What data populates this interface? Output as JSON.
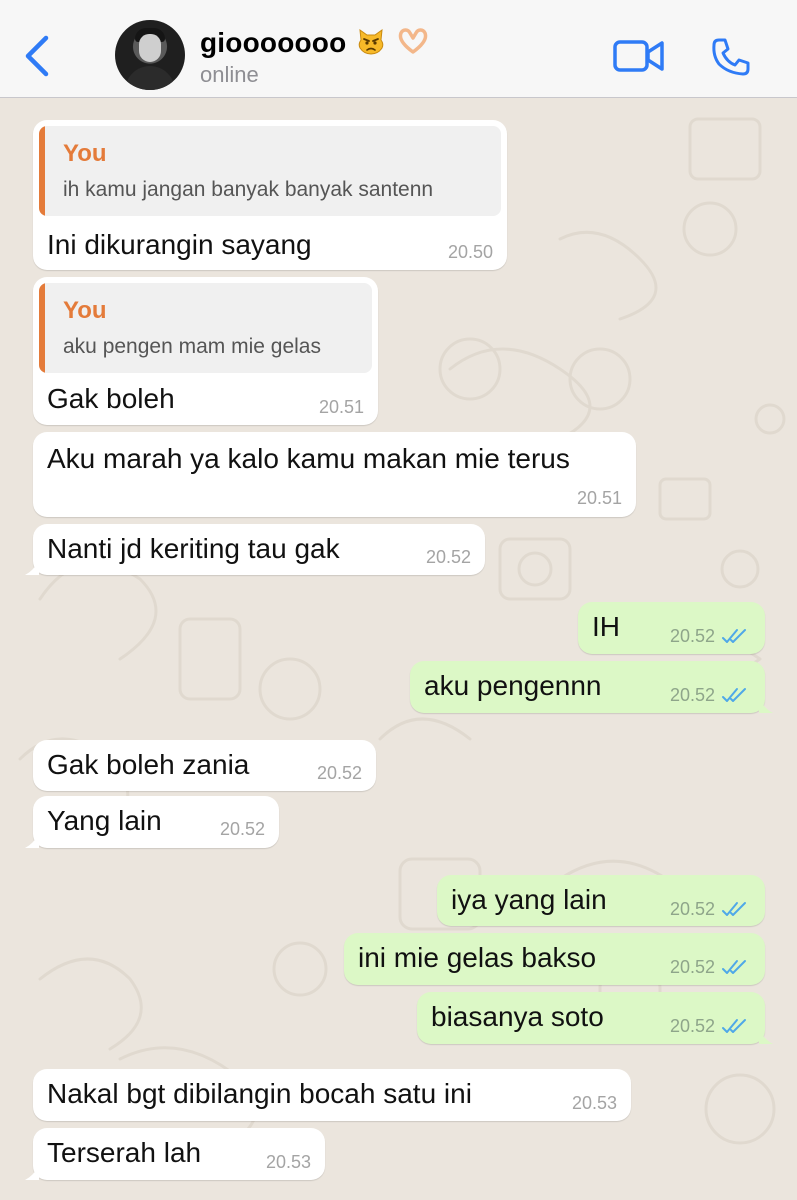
{
  "header": {
    "name": "giooooooo",
    "status": "online",
    "emoji_1": "pouting-cat",
    "emoji_2": "heart-hands"
  },
  "colors": {
    "accent": "#2f7bf6",
    "incoming": "#ffffff",
    "outgoing": "#dcf8c6",
    "quote": "#e47b3a",
    "read_ticks": "#4fa8e8",
    "background": "#ebe5dd"
  },
  "messages": [
    {
      "dir": "in",
      "quote_author": "You",
      "quote_text": "ih kamu jangan banyak banyak santenn",
      "text": "Ini dikurangin sayang",
      "time": "20.50"
    },
    {
      "dir": "in",
      "quote_author": "You",
      "quote_text": "aku pengen mam mie gelas",
      "text": "Gak boleh",
      "time": "20.51"
    },
    {
      "dir": "in",
      "text": "Aku marah ya kalo kamu makan mie terus",
      "time": "20.51"
    },
    {
      "dir": "in",
      "text": "Nanti jd keriting tau gak",
      "time": "20.52"
    },
    {
      "dir": "out",
      "text": "IH",
      "time": "20.52",
      "read": true
    },
    {
      "dir": "out",
      "text": "aku pengennn",
      "time": "20.52",
      "read": true
    },
    {
      "dir": "in",
      "text": "Gak boleh zania",
      "time": "20.52"
    },
    {
      "dir": "in",
      "text": "Yang lain",
      "time": "20.52"
    },
    {
      "dir": "out",
      "text": "iya yang lain",
      "time": "20.52",
      "read": true
    },
    {
      "dir": "out",
      "text": "ini mie gelas bakso",
      "time": "20.52",
      "read": true
    },
    {
      "dir": "out",
      "text": "biasanya soto",
      "time": "20.52",
      "read": true
    },
    {
      "dir": "in",
      "text": "Nakal bgt dibilangin bocah satu ini",
      "time": "20.53"
    },
    {
      "dir": "in",
      "text": "Terserah lah",
      "time": "20.53"
    }
  ]
}
